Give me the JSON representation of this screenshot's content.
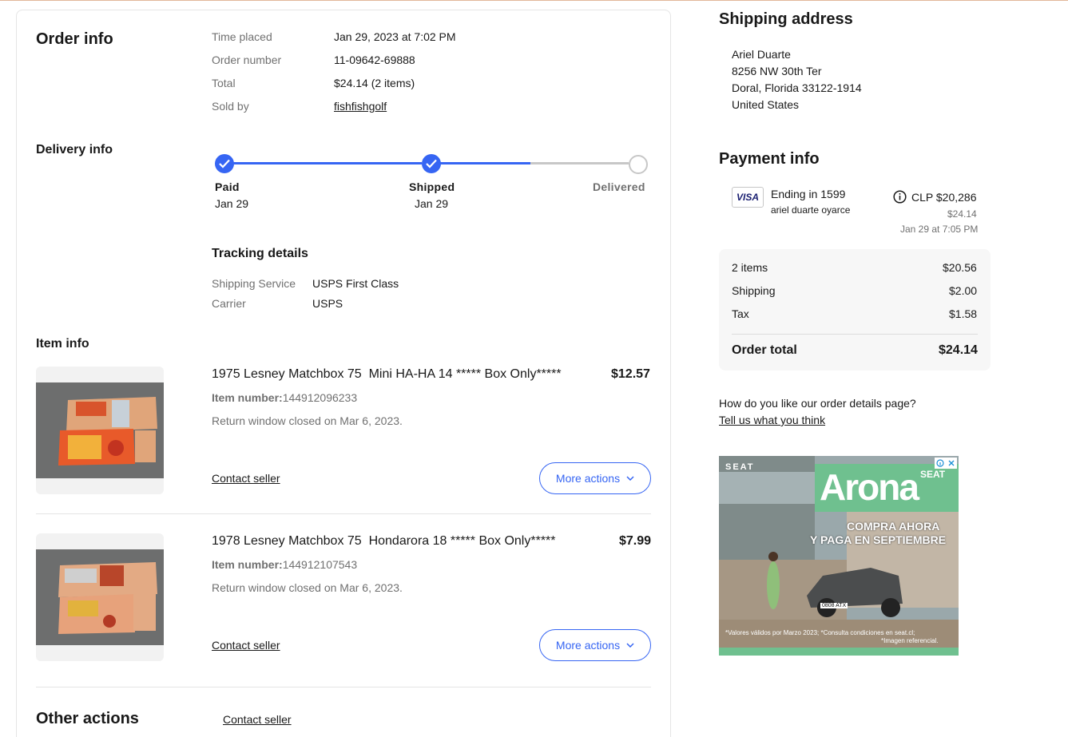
{
  "order_info": {
    "heading": "Order info",
    "rows": [
      {
        "label": "Time placed",
        "value": "Jan 29, 2023 at 7:02 PM"
      },
      {
        "label": "Order number",
        "value": "11-09642-69888"
      },
      {
        "label": "Total",
        "value": "$24.14 (2 items)"
      },
      {
        "label": "Sold by",
        "value": "fishfishgolf"
      }
    ]
  },
  "delivery": {
    "heading": "Delivery info",
    "progress_fraction": 0.74,
    "steps": [
      {
        "name": "Paid",
        "date": "Jan 29",
        "done": true
      },
      {
        "name": "Shipped",
        "date": "Jan 29",
        "done": true
      },
      {
        "name": "Delivered",
        "date": "",
        "done": false
      }
    ],
    "tracking": {
      "heading": "Tracking details",
      "rows": [
        {
          "label": "Shipping Service",
          "value": "USPS First Class"
        },
        {
          "label": "Carrier",
          "value": "USPS"
        }
      ]
    }
  },
  "items": {
    "heading": "Item info",
    "list": [
      {
        "title": "1975 Lesney Matchbox 75  Mini HA-HA 14 ***** Box Only*****",
        "price": "$12.57",
        "item_number_label": "Item number:",
        "item_number": "144912096233",
        "return_note": "Return window closed on Mar 6, 2023.",
        "contact": "Contact seller",
        "more_actions": "More actions"
      },
      {
        "title": "1978 Lesney Matchbox 75  Hondarora 18 ***** Box Only*****",
        "price": "$7.99",
        "item_number_label": "Item number:",
        "item_number": "144912107543",
        "return_note": "Return window closed on Mar 6, 2023.",
        "contact": "Contact seller",
        "more_actions": "More actions"
      }
    ]
  },
  "other_actions": {
    "heading": "Other actions",
    "contact": "Contact seller"
  },
  "shipping_address": {
    "heading": "Shipping address",
    "lines": [
      "Ariel Duarte",
      "8256 NW 30th Ter",
      "Doral, Florida 33122-1914",
      "United States"
    ]
  },
  "payment": {
    "heading": "Payment info",
    "card_brand": "VISA",
    "card_ending": "Ending in 1599",
    "card_holder": "ariel duarte oyarce",
    "amount_local": "CLP $20,286",
    "amount_usd": "$24.14",
    "paid_at": "Jan 29 at 7:05 PM",
    "summary": [
      {
        "label": "2 items",
        "value": "$20.56"
      },
      {
        "label": "Shipping",
        "value": "$2.00"
      },
      {
        "label": "Tax",
        "value": "$1.58"
      }
    ],
    "total_label": "Order total",
    "total_value": "$24.14"
  },
  "feedback": {
    "question": "How do you like our order details page?",
    "link": "Tell us what you think"
  },
  "ad": {
    "brand": "SEAT",
    "model": "Arona",
    "model_tag": "SEAT",
    "headline1": "COMPRA AHORA",
    "headline2": "Y PAGA EN SEPTIEMBRE",
    "plate": "0808 ATX",
    "fineprint1": "*Valores válidos por Marzo 2023; *Consulta condiciones en seat.cl;",
    "fineprint2": "*Imagen referencial."
  },
  "colors": {
    "accent": "#3665f3",
    "progress_gray": "#c7c7c7",
    "muted_text": "#707070"
  }
}
